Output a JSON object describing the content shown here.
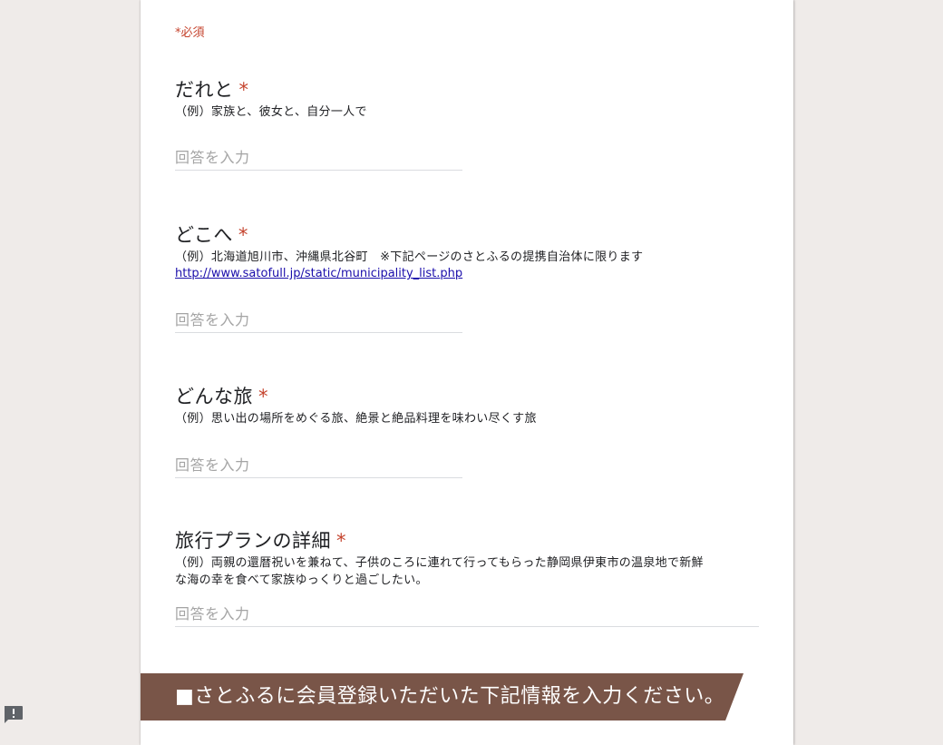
{
  "form": {
    "required_note": "*必須",
    "required_star": "*",
    "answer_placeholder": "回答を入力",
    "questions": [
      {
        "title": "だれと",
        "description": "（例）家族と、彼女と、自分一人で"
      },
      {
        "title": "どこへ",
        "description": "（例）北海道旭川市、沖縄県北谷町　※下記ページのさとふるの提携自治体に限ります",
        "link": "http://www.satofull.jp/static/municipality_list.php"
      },
      {
        "title": "どんな旅",
        "description": "（例）思い出の場所をめぐる旅、絶景と絶品料理を味わい尽くす旅"
      },
      {
        "title": "旅行プランの詳細",
        "description_line1": "（例）両親の還暦祝いを兼ねて、子供のころに連れて行ってもらった静岡県伊東市の温泉地で新鮮",
        "description_line2": "な海の幸を食べて家族ゆっくりと過ごしたい。"
      }
    ],
    "section_banner": "■さとふるに会員登録いただいた下記情報を入力ください。"
  },
  "icons": {
    "feedback": "feedback-icon"
  },
  "colors": {
    "page_bg": "#efebe9",
    "required": "#c5432d",
    "banner_bg": "#795548",
    "link": "#1a0dab"
  }
}
